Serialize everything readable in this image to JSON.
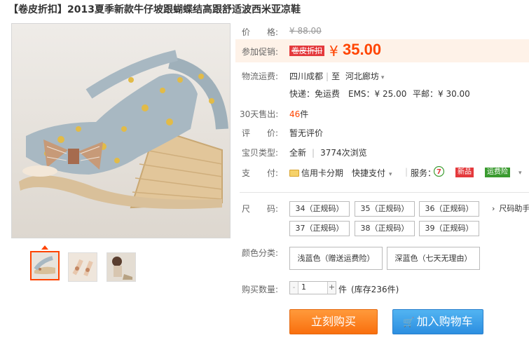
{
  "title": "【卷皮折扣】2013夏季新款牛仔坡跟蝴蝶结高跟舒适波西米亚凉鞋",
  "colors": {
    "accent": "#ff4400",
    "buy_button": "#f96f0e",
    "cart_button": "#2c8ee0"
  },
  "price": {
    "label": "价　　格:",
    "original": "¥ 88.00"
  },
  "promo": {
    "label": "参加促销:",
    "badge": "卷皮折扣",
    "currency": "¥",
    "value": "35.00"
  },
  "shipping": {
    "label": "物流运费:",
    "from": "四川成都",
    "separator": "|",
    "to_prefix": "至",
    "to": "河北廊坊",
    "express": "快递：免运费",
    "ems": "EMS：¥ 25.00",
    "mail": "平邮：¥ 30.00"
  },
  "sales": {
    "label": "30天售出:",
    "count": "46",
    "unit": "件"
  },
  "rating": {
    "label": "评　　价:",
    "value": "暂无评价"
  },
  "item_type": {
    "label": "宝贝类型:",
    "value": "全新",
    "separator": "|",
    "views": "3774次浏览"
  },
  "payment": {
    "label": "支　　付:",
    "card": "信用卡分期",
    "quick": "快捷支付",
    "service_label": "服务：",
    "service_icon": "seven-day-return-icon",
    "tag_new": "新品",
    "tag_insurance": "运费险"
  },
  "size": {
    "label": "尺　　码:",
    "options": [
      "34（正规码）",
      "35（正规码）",
      "36（正规码）",
      "37（正规码）",
      "38（正规码）",
      "39（正规码）"
    ],
    "helper": "尺码助手"
  },
  "color": {
    "label": "颜色分类:",
    "options": [
      "浅蓝色（赠送运费险）",
      "深蓝色（七天无理由）"
    ]
  },
  "quantity": {
    "label": "购买数量:",
    "value": "1",
    "minus": "-",
    "plus": "+",
    "unit": "件",
    "stock": "(库存236件)"
  },
  "actions": {
    "buy": "立刻购买",
    "cart": "加入购物车"
  }
}
